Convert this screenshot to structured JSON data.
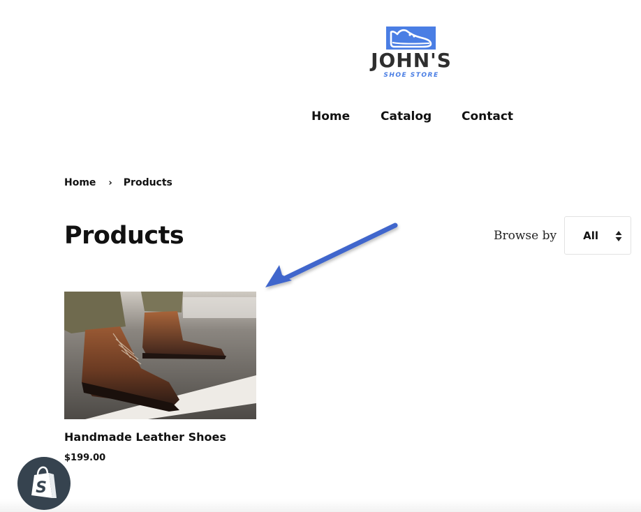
{
  "store": {
    "logo_name": "JOHN'S",
    "logo_tagline": "SHOE STORE",
    "logo_icon": "sneaker-icon",
    "brand_color": "#4a7ee4"
  },
  "nav": {
    "items": [
      {
        "label": "Home"
      },
      {
        "label": "Catalog"
      },
      {
        "label": "Contact"
      }
    ]
  },
  "breadcrumb": {
    "items": [
      {
        "label": "Home"
      },
      {
        "label": "Products"
      }
    ],
    "separator": "›"
  },
  "page": {
    "title": "Products"
  },
  "browse": {
    "label": "Browse by",
    "selected": "All"
  },
  "annotation": {
    "arrow_color": "#3f66cc",
    "arrow_icon": "arrow-pointing-to-product-icon"
  },
  "products": [
    {
      "title": "Handmade Leather Shoes",
      "price": "$199.00",
      "image": "brown leather lace-up boots on pavement"
    }
  ],
  "footer": {
    "badge_icon": "shopify-bag-icon"
  }
}
